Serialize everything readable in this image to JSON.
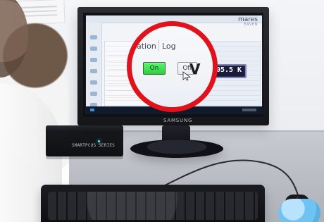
{
  "scene": {
    "monitor_brand": "SAMSUNG",
    "device_label": "SMARTPCUS SERIES",
    "screen_brand": "mares",
    "screen_brand_small": "EAVEN",
    "screen_value": "305.5 K"
  },
  "zoom": {
    "tab_left": "ation",
    "tab_right": "Log",
    "on_label": "On",
    "off_label": "Off",
    "v_label": "V"
  },
  "colors": {
    "zoom_ring": "#e0121b",
    "on_green": "#2fce3f"
  }
}
